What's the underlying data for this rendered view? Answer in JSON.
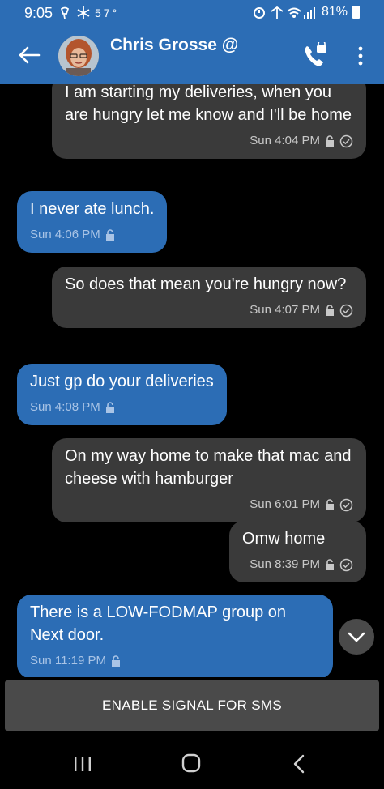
{
  "status_bar": {
    "time": "9:05",
    "left_icons": "🂠 ✲ 57°",
    "battery_pct": "81%"
  },
  "header": {
    "contact_name": "Chris Grosse @"
  },
  "messages": [
    {
      "dir": "out",
      "text": "I am starting my deliveries, when you are hungry let me know and I'll be home",
      "time": "Sun 4:04 PM"
    },
    {
      "dir": "in",
      "text": "I never ate lunch.",
      "time": "Sun 4:06 PM"
    },
    {
      "dir": "out",
      "text": "So does that mean you're hungry now?",
      "time": "Sun 4:07 PM"
    },
    {
      "dir": "in",
      "text": "Just gp do your deliveries",
      "time": "Sun 4:08 PM"
    },
    {
      "dir": "out",
      "text": "On my way home to make that mac and cheese with hamburger",
      "time": "Sun 6:01 PM"
    },
    {
      "dir": "out",
      "text": "Omw home",
      "time": "Sun 8:39 PM"
    },
    {
      "dir": "in",
      "text": "There is a LOW-FODMAP group on Next door.",
      "time": "Sun 11:19 PM"
    }
  ],
  "enable_sms_label": "ENABLE SIGNAL FOR SMS",
  "colors": {
    "signal_blue": "#2c6db5",
    "outgoing_bubble": "#3a3a3a",
    "background": "#000000"
  },
  "icons": [
    "back-arrow-icon",
    "call-icon",
    "more-vert-icon",
    "lock-icon",
    "check-circle-icon",
    "chevron-down-icon",
    "recents-icon",
    "home-icon",
    "nav-back-icon"
  ]
}
